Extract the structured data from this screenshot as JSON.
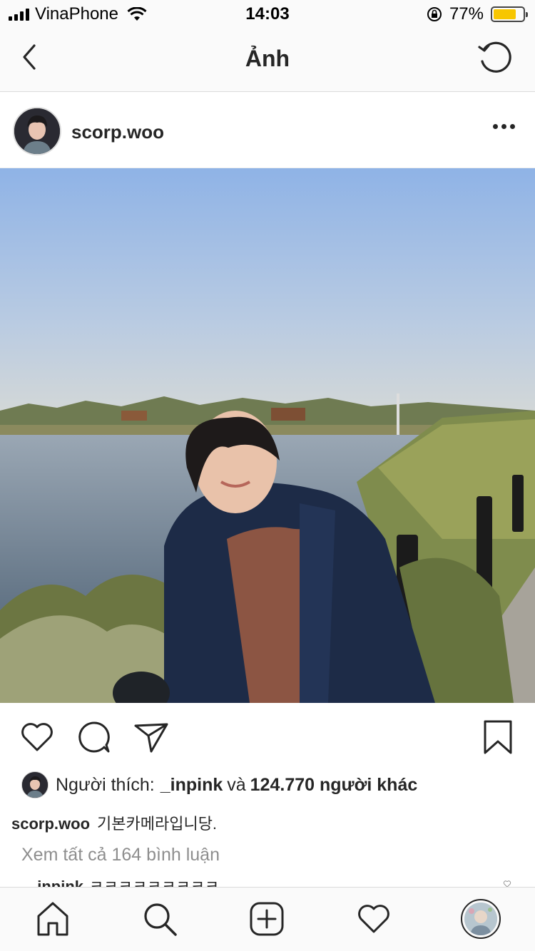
{
  "status_bar": {
    "carrier": "VinaPhone",
    "time": "14:03",
    "battery": "77%",
    "battery_level": 0.77
  },
  "nav": {
    "title": "Ảnh",
    "back_icon": "chevron-left-icon",
    "refresh_icon": "refresh-icon"
  },
  "post": {
    "username": "scorp.woo",
    "more_icon": "more-dots-icon"
  },
  "actions": {
    "like_icon": "heart-icon",
    "comment_icon": "comment-icon",
    "share_icon": "send-icon",
    "save_icon": "bookmark-icon"
  },
  "likes": {
    "prefix": "Người thích:",
    "liker": "_inpink",
    "conjunction": "và",
    "others": "124.770 người khác"
  },
  "caption": {
    "user": "scorp.woo",
    "text": "기본카메라입니당."
  },
  "comments": {
    "view_all": "Xem tất cả 164 bình luận",
    "peek_user": "_inpink",
    "peek_text": "ㅋㅋㅋㅋㅋㅋㅋㅋㅋ"
  },
  "tab_bar": {
    "items": [
      "home-icon",
      "search-icon",
      "add-post-icon",
      "activity-heart-icon",
      "profile-avatar"
    ]
  },
  "colors": {
    "text": "#262626",
    "muted": "#8e8e8e",
    "battery": "#f7c600",
    "border": "#dbdbdb"
  }
}
